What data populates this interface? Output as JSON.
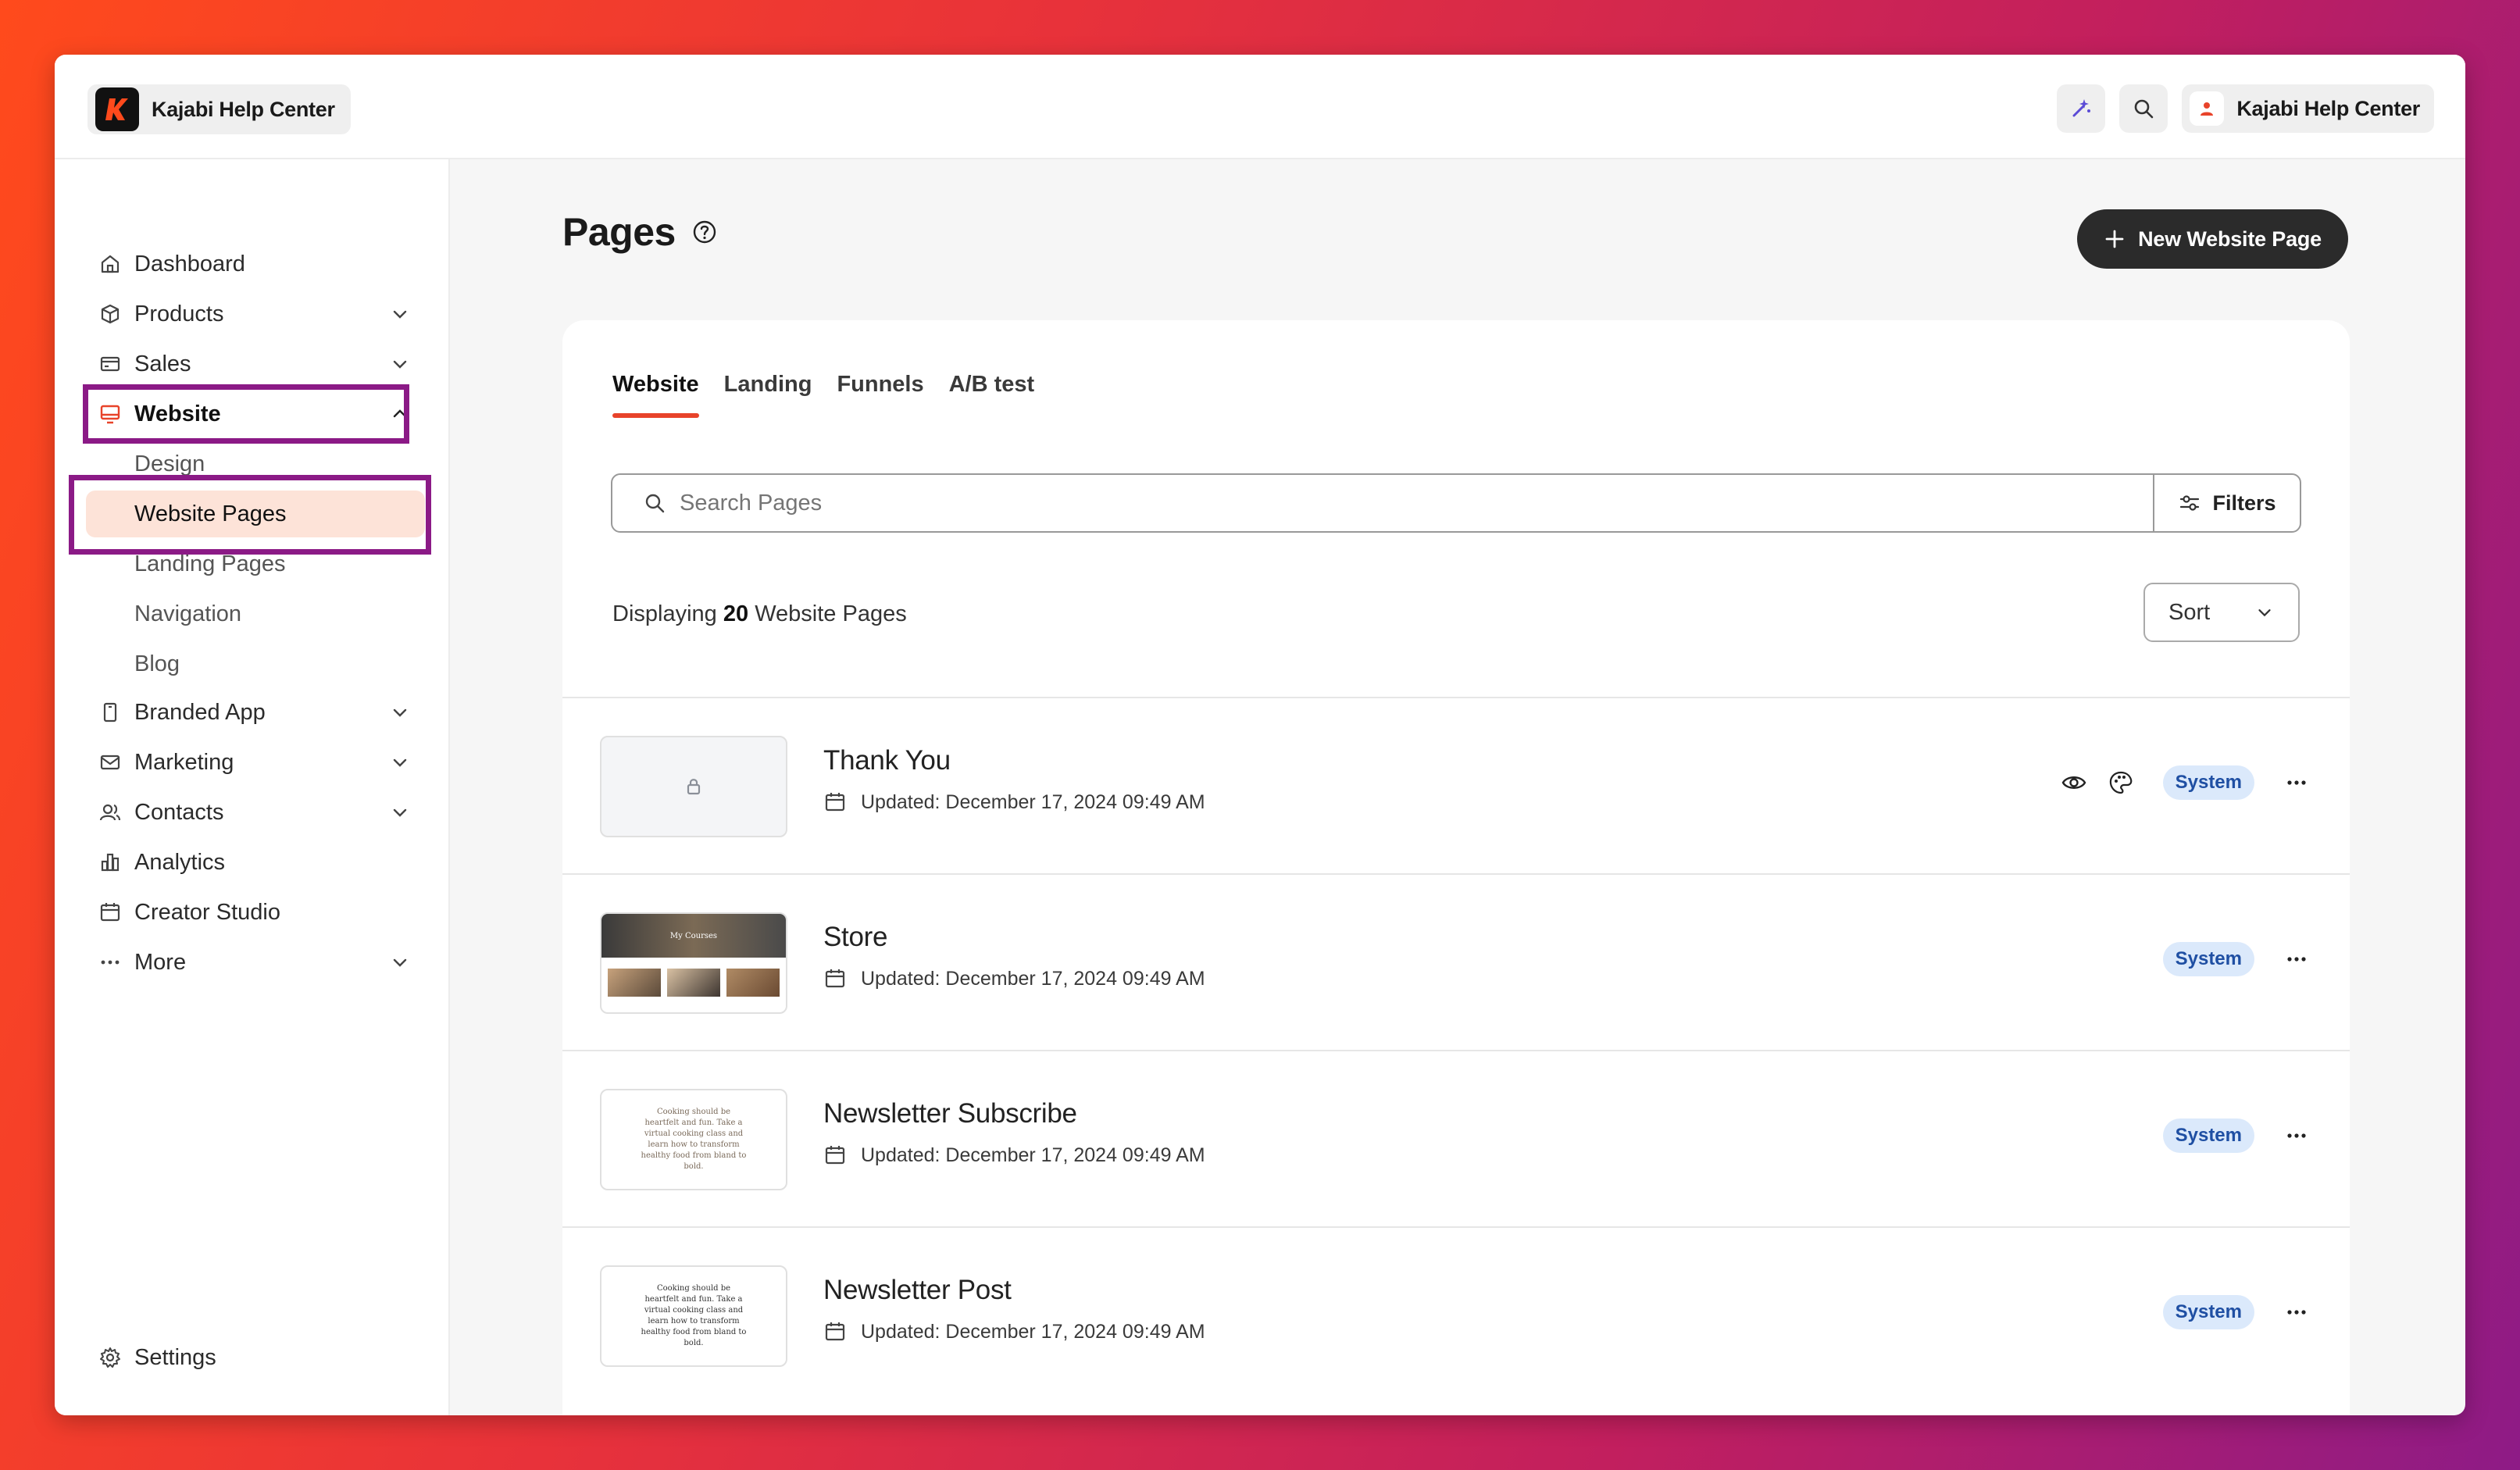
{
  "brand": {
    "name": "Kajabi Help Center",
    "logo_letter": "K"
  },
  "topbar": {
    "user_name": "Kajabi Help Center"
  },
  "sidebar": {
    "items": [
      {
        "label": "Dashboard"
      },
      {
        "label": "Products"
      },
      {
        "label": "Sales"
      },
      {
        "label": "Website"
      },
      {
        "label": "Branded App"
      },
      {
        "label": "Marketing"
      },
      {
        "label": "Contacts"
      },
      {
        "label": "Analytics"
      },
      {
        "label": "Creator Studio"
      },
      {
        "label": "More"
      },
      {
        "label": "Settings"
      }
    ],
    "website_sub": [
      {
        "label": "Design"
      },
      {
        "label": "Website Pages"
      },
      {
        "label": "Landing Pages"
      },
      {
        "label": "Navigation"
      },
      {
        "label": "Blog"
      }
    ]
  },
  "main": {
    "title": "Pages",
    "new_button": "New Website Page",
    "tabs": [
      {
        "label": "Website"
      },
      {
        "label": "Landing"
      },
      {
        "label": "Funnels"
      },
      {
        "label": "A/B test"
      }
    ],
    "search_placeholder": "Search Pages",
    "filters_label": "Filters",
    "display_prefix": "Displaying",
    "display_count": "20",
    "display_suffix": "Website Pages",
    "sort_label": "Sort",
    "rows": [
      {
        "title": "Thank You",
        "updated": "Updated: December 17, 2024 09:49 AM",
        "badge": "System"
      },
      {
        "title": "Store",
        "updated": "Updated: December 17, 2024 09:49 AM",
        "badge": "System",
        "thumb_caption": "My Courses"
      },
      {
        "title": "Newsletter Subscribe",
        "updated": "Updated: December 17, 2024 09:49 AM",
        "badge": "System",
        "thumb_text": "Cooking should be heartfelt and fun. Take a virtual cooking class and learn how to transform healthy food from bland to bold."
      },
      {
        "title": "Newsletter Post",
        "updated": "Updated: December 17, 2024 09:49 AM",
        "badge": "System",
        "thumb_text": "Cooking should be heartfelt and fun. Take a virtual cooking class and learn how to transform healthy food from bland to bold."
      }
    ]
  },
  "colors": {
    "accent": "#e8432a",
    "highlight": "#8b1a86",
    "badge_bg": "#dbe9fb",
    "badge_text": "#1f4fa3"
  }
}
